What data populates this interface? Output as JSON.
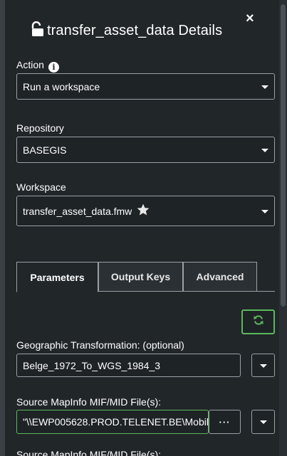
{
  "header": {
    "title": "transfer_asset_data Details",
    "lock_icon": "unlocked-padlock-icon",
    "close_label": "×"
  },
  "action": {
    "label": "Action",
    "info_glyph": "i",
    "value": "Run a workspace"
  },
  "repository": {
    "label": "Repository",
    "value": "BASEGIS"
  },
  "workspace": {
    "label": "Workspace",
    "value": "transfer_asset_data.fmw",
    "favorite_icon": "star-icon"
  },
  "tabs": [
    {
      "label": "Parameters",
      "active": true
    },
    {
      "label": "Output Keys",
      "active": false
    },
    {
      "label": "Advanced",
      "active": false
    }
  ],
  "parameters": {
    "refresh_icon": "refresh-icon",
    "geo_label": "Geographic Transformation: (optional)",
    "geo_value": "Belge_1972_To_WGS_1984_3",
    "source_label": "Source MapInfo MIF/MID File(s):",
    "source_value": "\"\\\\EWP005628.PROD.TELENET.BE\\Mobil",
    "browse_label": "···",
    "next_label": "Source MapInfo MIF/MID File(s):"
  },
  "colors": {
    "background": "#212629",
    "accent_green": "#5cb85c",
    "border": "#9aa0a6"
  }
}
